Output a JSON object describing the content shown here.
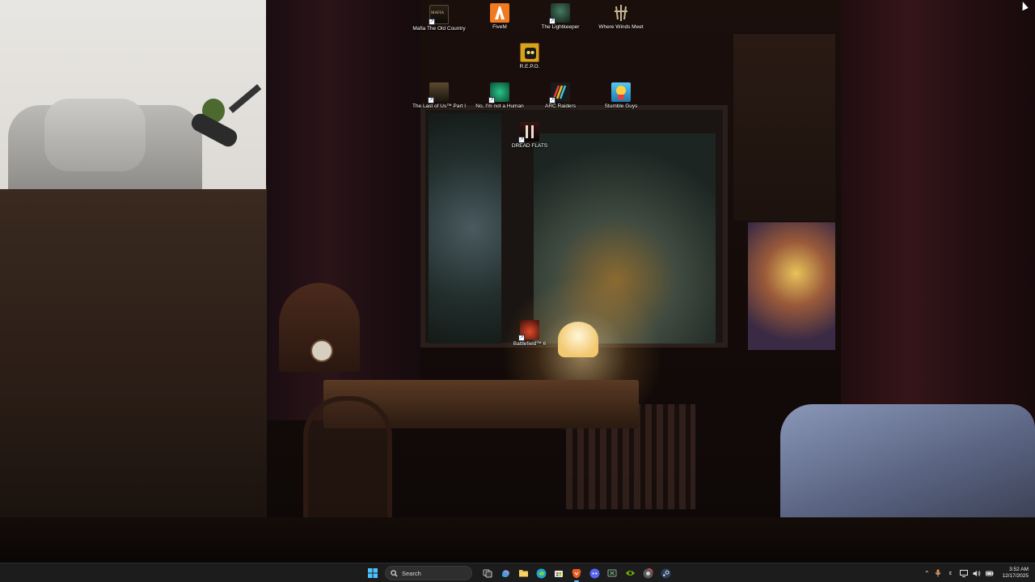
{
  "desktop": {
    "icons": [
      {
        "label": "Mafia The Old Country",
        "icon": "mafia-icon",
        "color": "#1a1410"
      },
      {
        "label": "FiveM",
        "icon": "fivem-icon",
        "color": "#f07a20"
      },
      {
        "label": "The Lightkeeper",
        "icon": "lightkeeper-icon",
        "color": "#1e3a30"
      },
      {
        "label": "Where Winds Meet",
        "icon": "where-winds-meet-icon",
        "color": "#3a2a1a"
      },
      {
        "label": "R.E.P.O.",
        "icon": "repo-icon",
        "color": "#d9a21a"
      },
      {
        "label": "The Last of Us™ Part I",
        "icon": "last-of-us-icon",
        "color": "#3a3020"
      },
      {
        "label": "No, I'm not a Human",
        "icon": "not-a-human-icon",
        "color": "#1a9a6a"
      },
      {
        "label": "ARC Raiders",
        "icon": "arc-raiders-icon",
        "color": "#222222"
      },
      {
        "label": "Stumble Guys",
        "icon": "stumble-guys-icon",
        "color": "#2a9ad8"
      },
      {
        "label": "DREAD FLATS",
        "icon": "dread-flats-icon",
        "color": "#2a0e0e"
      },
      {
        "label": "Battlefield™ 6",
        "icon": "battlefield-6-icon",
        "color": "#c03020"
      }
    ]
  },
  "taskbar": {
    "search_label": "Search",
    "apps": [
      {
        "name": "task-view",
        "icon": "task-view-icon",
        "color": "#c8c8c8",
        "active": false
      },
      {
        "name": "copilot",
        "icon": "copilot-icon",
        "color": "#3aa0e8",
        "active": false
      },
      {
        "name": "file-explorer",
        "icon": "folder-icon",
        "color": "#f2c14e",
        "active": false
      },
      {
        "name": "edge",
        "icon": "edge-icon",
        "color": "#1fa3c8",
        "active": false
      },
      {
        "name": "microsoft-store",
        "icon": "store-icon",
        "color": "#e8e8e8",
        "active": false
      },
      {
        "name": "brave",
        "icon": "brave-icon",
        "color": "#f05a24",
        "active": true
      },
      {
        "name": "discord",
        "icon": "discord-icon",
        "color": "#5865f2",
        "active": false
      },
      {
        "name": "xbox",
        "icon": "xbox-icon",
        "color": "#9aa0a6",
        "active": false
      },
      {
        "name": "nvidia",
        "icon": "nvidia-icon",
        "color": "#76b900",
        "active": false
      },
      {
        "name": "chrome",
        "icon": "chrome-icon",
        "color": "#9aa0a6",
        "active": false
      },
      {
        "name": "steam",
        "icon": "steam-icon",
        "color": "#c6d4df",
        "active": false
      }
    ],
    "tray": {
      "chevron": "chevron-up-icon",
      "mic": "microphone-icon",
      "lang": "ε",
      "time": "3:52 AM",
      "date": "12/17/2025"
    }
  },
  "colors": {
    "taskbar_bg": "#1c1c1c",
    "accent": "#60b0ff",
    "windows_logo": "#4cc2ff"
  }
}
